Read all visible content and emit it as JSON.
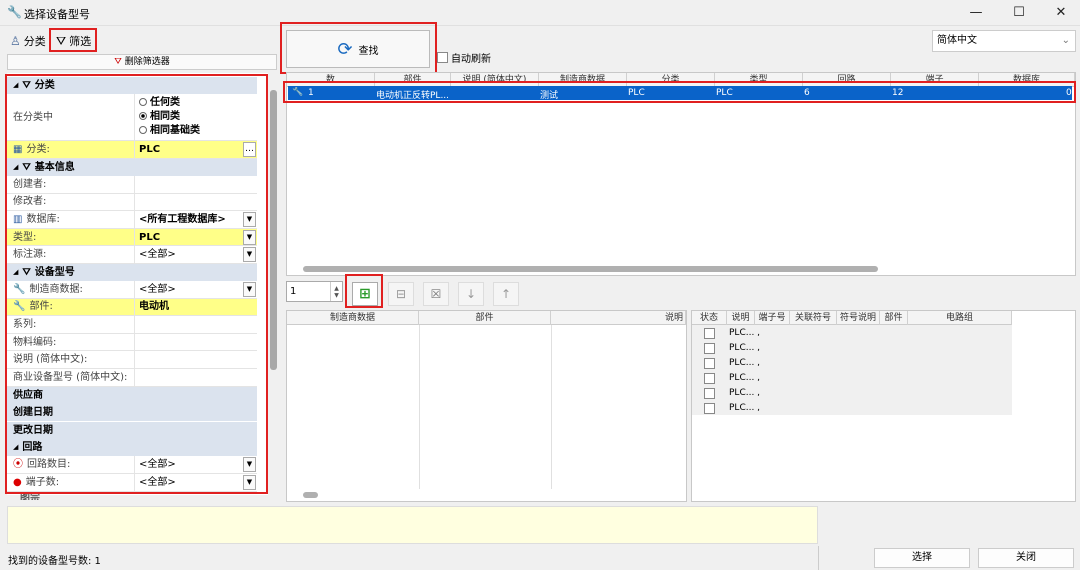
{
  "window": {
    "title": "选择设备型号"
  },
  "left_toolbar": {
    "classify_label": "分类",
    "filter_label": "筛选",
    "delete_filter_label": "删除筛选器"
  },
  "filter": {
    "sections": {
      "classify": "分类",
      "basic": "基本信息",
      "model": "设备型号",
      "supplier": "供应商",
      "created": "创建日期",
      "modified": "更改日期",
      "circuit": "回路",
      "graphic": "图宗"
    },
    "in_classify_label": "在分类中",
    "radio_options": [
      "任何类",
      "相同类",
      "相同基础类"
    ],
    "radio_selected": 1,
    "classify_row": {
      "label": "分类:",
      "value": "PLC"
    },
    "creator_label": "创建者:",
    "modifier_label": "修改者:",
    "database_row": {
      "label": "数据库:",
      "value": "<所有工程数据库>"
    },
    "type_row": {
      "label": "类型:",
      "value": "PLC"
    },
    "note_source_row": {
      "label": "标注源:",
      "value": "<全部>"
    },
    "manufacturer_row": {
      "label": "制造商数据:",
      "value": "<全部>"
    },
    "part_row": {
      "label": "部件:",
      "value": "电动机"
    },
    "series_label": "系列:",
    "material_label": "物料编码:",
    "desc_label": "说明 (简体中文):",
    "commercial_label": "商业设备型号 (简体中文):",
    "circuit_count_row": {
      "label": "回路数目:",
      "value": "<全部>"
    },
    "terminal_count_row": {
      "label": "端子数:",
      "value": "<全部>"
    }
  },
  "search": {
    "button_label": "查找",
    "auto_refresh_label": "自动刷新",
    "language": "简体中文"
  },
  "results": {
    "headers": [
      "数",
      "部件",
      "说明 (简体中文)",
      "制造商数据",
      "分类",
      "类型",
      "回路",
      "端子",
      "数据库"
    ],
    "row": {
      "num": "1",
      "part": "电动机正反转PL...",
      "desc": "",
      "manufacturer": "测试",
      "classify": "PLC",
      "type": "PLC",
      "circuits": "6",
      "terminals": "12",
      "database": "0"
    }
  },
  "bottom": {
    "spinner_value": "1",
    "left_headers": [
      "制造商数据",
      "部件",
      "说明"
    ],
    "right_headers": [
      "状态",
      "说明",
      "端子号",
      "关联符号",
      "符号说明",
      "部件",
      "电路组"
    ],
    "right_rows": [
      "PLC... ,",
      "PLC... ,",
      "PLC... ,",
      "PLC... ,",
      "PLC... ,",
      "PLC... ,"
    ]
  },
  "status": {
    "found_label": "找到的设备型号数: 1"
  },
  "buttons": {
    "select": "选择",
    "close": "关闭"
  }
}
